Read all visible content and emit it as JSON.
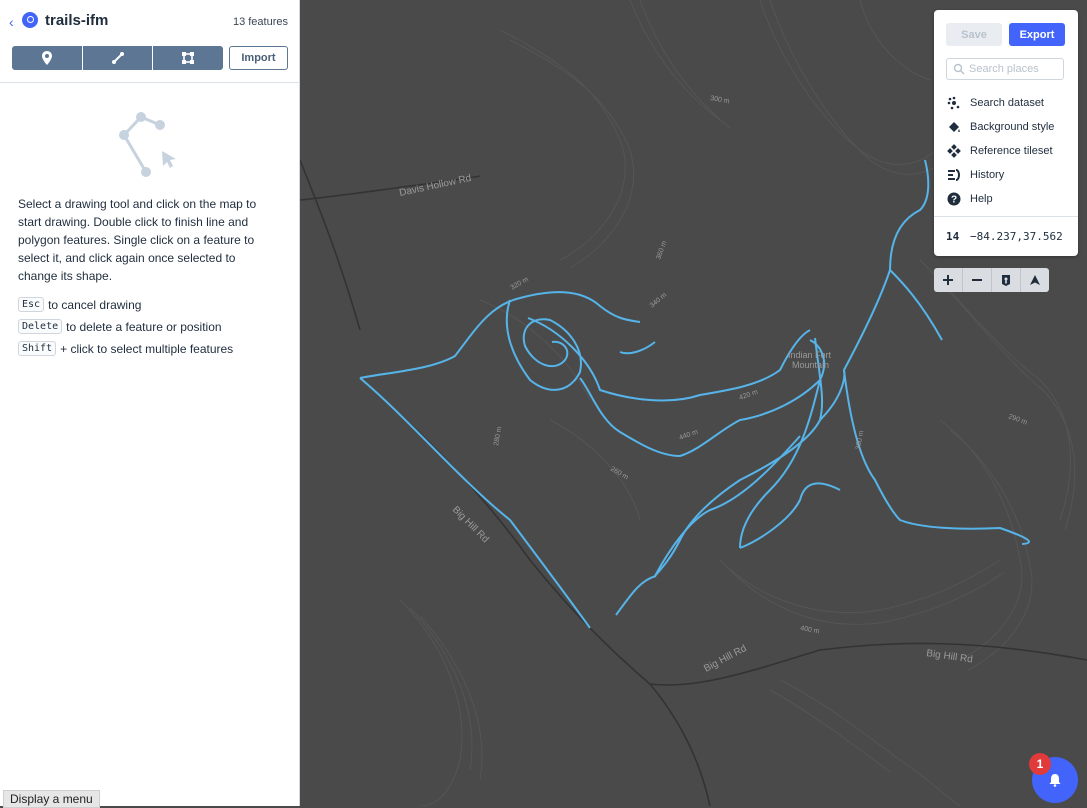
{
  "sidebar": {
    "title": "trails-ifm",
    "feature_count": "13 features",
    "tools": [
      {
        "name": "point-tool",
        "icon": "map-pin-icon"
      },
      {
        "name": "line-tool",
        "icon": "line-icon"
      },
      {
        "name": "polygon-tool",
        "icon": "polygon-icon"
      }
    ],
    "import_label": "Import",
    "instructions": "Select a drawing tool and click on the map to start drawing. Double click to finish line and polygon features. Single click on a feature to select it, and click again once selected to change its shape.",
    "shortcuts": [
      {
        "key": "Esc",
        "text": "to cancel drawing"
      },
      {
        "key": "Delete",
        "text": "to delete a feature or position"
      },
      {
        "key": "Shift",
        "text": "+ click to select multiple features"
      }
    ],
    "display_menu_label": "Display a menu"
  },
  "panel": {
    "save_label": "Save",
    "export_label": "Export",
    "search_placeholder": "Search places",
    "menu": [
      {
        "label": "Search dataset",
        "icon": "search-dataset-icon"
      },
      {
        "label": "Background style",
        "icon": "paint-bucket-icon"
      },
      {
        "label": "Reference tileset",
        "icon": "tileset-icon"
      },
      {
        "label": "History",
        "icon": "history-icon"
      },
      {
        "label": "Help",
        "icon": "help-icon"
      }
    ],
    "zoom": "14",
    "coordinates": "−84.237,37.562"
  },
  "map": {
    "road_labels": [
      "Davis Hollow Rd",
      "Big Hill Rd",
      "Big Hill Rd",
      "Big Hill Rd"
    ],
    "place_label": [
      "Indian Fort",
      "Mountain"
    ],
    "contour_labels": [
      "320 m",
      "340 m",
      "360 m",
      "280 m",
      "300 m",
      "400 m",
      "420 m",
      "440 m",
      "260 m",
      "380 m",
      "290 m"
    ],
    "trail_color": "#56b4e9"
  },
  "notifications": {
    "count": "1"
  }
}
